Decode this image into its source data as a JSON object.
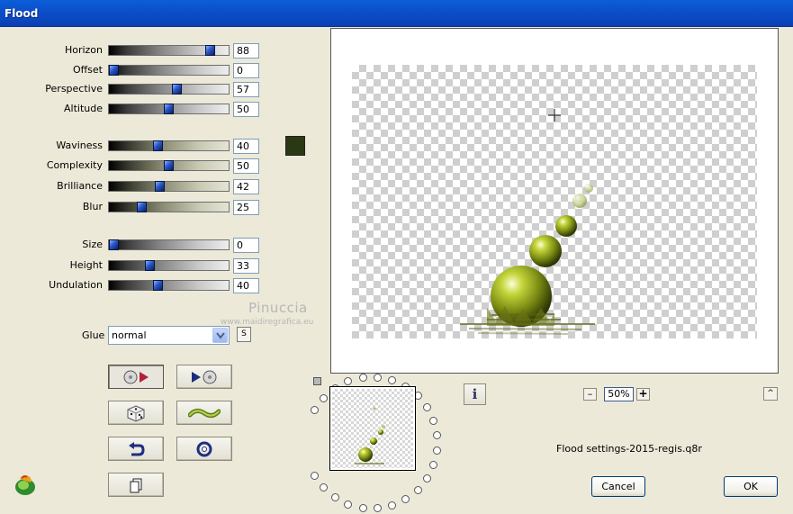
{
  "window": {
    "title": "Flood"
  },
  "sliders": [
    {
      "label": "Horizon",
      "value": "88",
      "level": 0.88,
      "style": "grey"
    },
    {
      "label": "Offset",
      "value": "0",
      "level": 0.0,
      "style": "grey"
    },
    {
      "label": "Perspective",
      "value": "57",
      "level": 0.57,
      "style": "grey"
    },
    {
      "label": "Altitude",
      "value": "50",
      "level": 0.5,
      "style": "grey"
    },
    {
      "label": "Waviness",
      "value": "40",
      "level": 0.4,
      "style": "olive"
    },
    {
      "label": "Complexity",
      "value": "50",
      "level": 0.5,
      "style": "olive"
    },
    {
      "label": "Brilliance",
      "value": "42",
      "level": 0.42,
      "style": "olive"
    },
    {
      "label": "Blur",
      "value": "25",
      "level": 0.25,
      "style": "olive"
    },
    {
      "label": "Size",
      "value": "0",
      "level": 0.0,
      "style": "grey"
    },
    {
      "label": "Height",
      "value": "33",
      "level": 0.33,
      "style": "grey"
    },
    {
      "label": "Undulation",
      "value": "40",
      "level": 0.4,
      "style": "grey"
    }
  ],
  "color_swatch": "#2b3814",
  "glue": {
    "label": "Glue",
    "value": "normal",
    "s_button": "S"
  },
  "watermark": {
    "name": "Pinuccia",
    "site": "www.maidiregrafica.eu"
  },
  "tools": {
    "icons": [
      "reset-filter-icon",
      "apply-filter-icon",
      "random-dice-icon",
      "wave-icon",
      "undo-icon",
      "target-icon",
      "copy-icon"
    ]
  },
  "preview": {
    "info_label": "i",
    "zoom": "50%",
    "zoom_minus": "–",
    "zoom_plus": "+",
    "up_label": "^"
  },
  "settings_file": "Flood settings-2015-regis.q8r",
  "buttons": {
    "cancel": "Cancel",
    "ok": "OK"
  }
}
